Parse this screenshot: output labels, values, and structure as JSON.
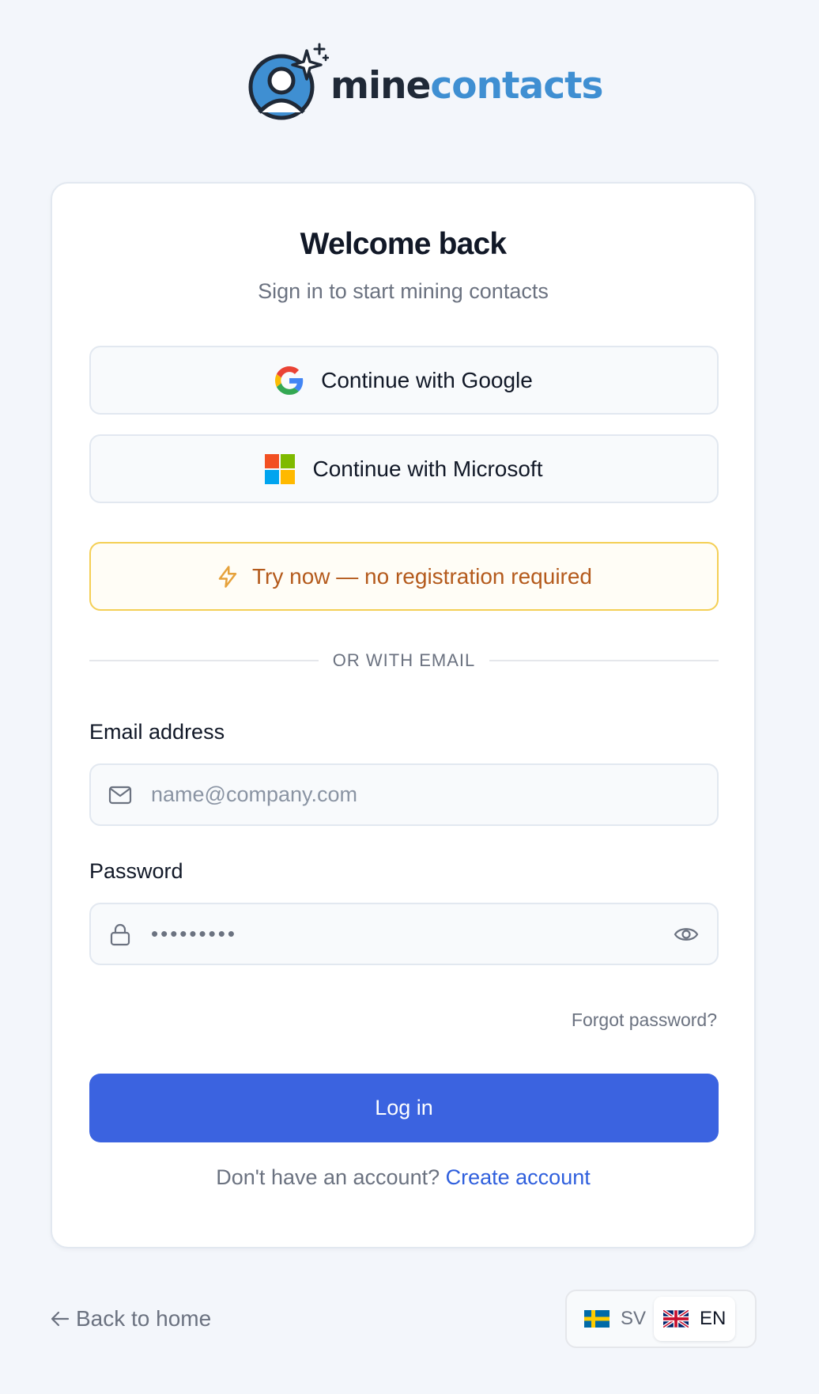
{
  "brand": {
    "name_part1": "mine",
    "name_part2": "contacts",
    "colors": {
      "dark": "#1f2937",
      "accent": "#3f8fd2"
    }
  },
  "card": {
    "title": "Welcome back",
    "subtitle": "Sign in to start mining contacts",
    "google_label": "Continue with Google",
    "microsoft_label": "Continue with Microsoft",
    "try_label": "Try now — no registration required",
    "divider_text": "OR WITH EMAIL",
    "email": {
      "label": "Email address",
      "placeholder": "name@company.com",
      "value": ""
    },
    "password": {
      "label": "Password",
      "value": "•••••••••"
    },
    "forgot_label": "Forgot password?",
    "login_label": "Log in",
    "signup_prompt": "Don't have an account?",
    "signup_link": "Create account"
  },
  "footer": {
    "back_label": "Back to home",
    "languages": [
      {
        "code": "SV",
        "flag": "sweden-flag-icon",
        "active": false
      },
      {
        "code": "EN",
        "flag": "uk-flag-icon",
        "active": true
      }
    ]
  },
  "icons": {
    "google": "google-icon",
    "microsoft": "microsoft-icon",
    "try": "lightning-icon",
    "email_field": "mail-icon",
    "password_field": "lock-icon",
    "toggle_visibility": "eye-icon",
    "back": "arrow-left-icon"
  },
  "colors": {
    "page_bg": "#f3f6fb",
    "primary": "#3b63e0",
    "link": "#2f5fdd",
    "try_border": "#f4cf55",
    "try_text": "#b45a1c"
  }
}
